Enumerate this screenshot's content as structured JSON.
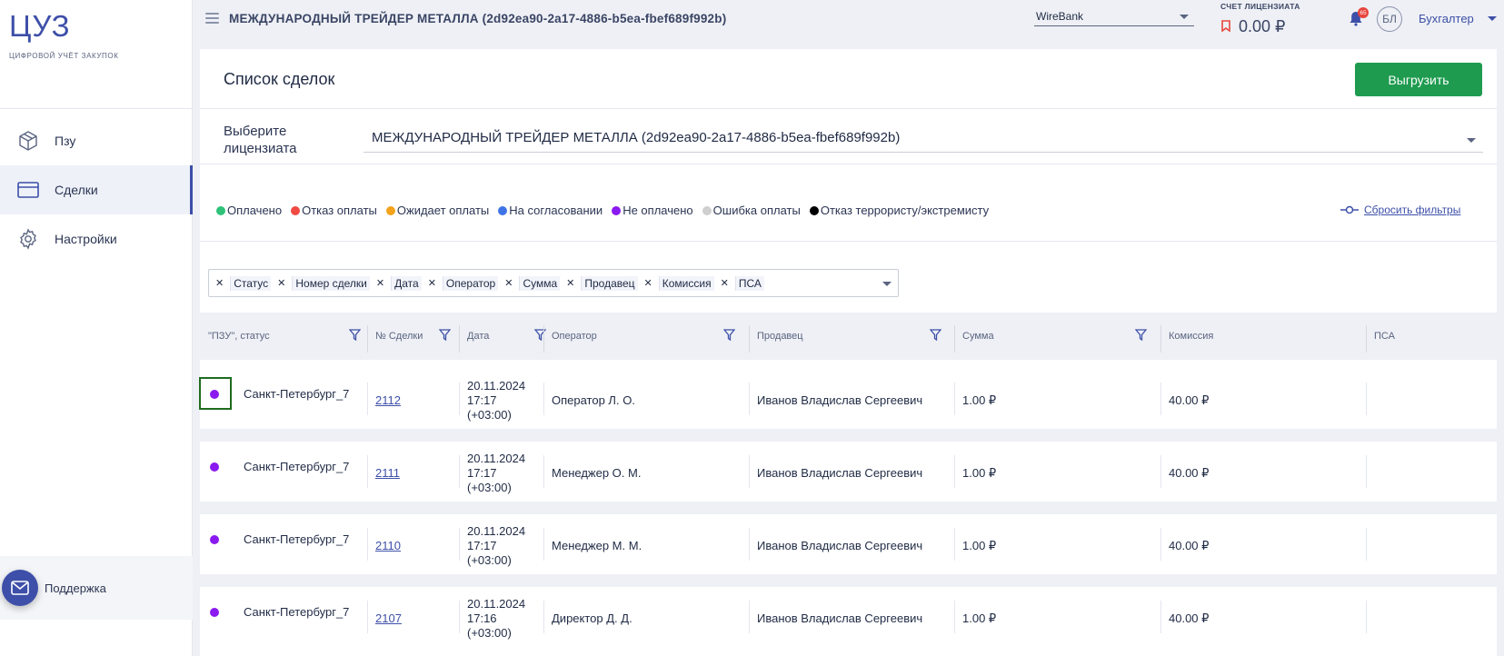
{
  "sidebar": {
    "logo": "ЦУЗ",
    "logo_sub": "ЦИФРОВОЙ УЧЁТ ЗАКУПОК",
    "items": [
      {
        "label": "Пзу",
        "icon": "cube-icon"
      },
      {
        "label": "Сделки",
        "icon": "card-icon",
        "active": true
      },
      {
        "label": "Настройки",
        "icon": "gear-icon"
      }
    ],
    "support_label": "Поддержка"
  },
  "topbar": {
    "title": "МЕЖДУНАРОДНЫЙ ТРЕЙДЕР МЕТАЛЛА (2d92ea90-2a17-4886-b5ea-fbef689f992b)",
    "bank": "WireBank",
    "account_label": "СЧЕТ ЛИЦЕНЗИАТА",
    "account_value": "0.00 ₽",
    "notifications": "65",
    "avatar": "БЛ",
    "role": "Бухгалтер"
  },
  "page": {
    "title": "Список сделок",
    "export_label": "Выгрузить",
    "licensee_label": "Выберите лицензиата",
    "licensee_value": "МЕЖДУНАРОДНЫЙ ТРЕЙДЕР МЕТАЛЛА (2d92ea90-2a17-4886-b5ea-fbef689f992b)",
    "reset_label": "Сбросить фильтры"
  },
  "legend": [
    {
      "label": "Оплачено",
      "color": "#2fc27a"
    },
    {
      "label": "Отказ оплаты",
      "color": "#f04a43"
    },
    {
      "label": "Ожидает оплаты",
      "color": "#f3a31c"
    },
    {
      "label": "На согласовании",
      "color": "#3f74e6"
    },
    {
      "label": "Не оплачено",
      "color": "#8a1aef"
    },
    {
      "label": "Ошибка оплаты",
      "color": "#cfcfcf"
    },
    {
      "label": "Отказ террористу/экстремисту",
      "color": "#000000"
    }
  ],
  "chips": [
    "Статус",
    "Номер сделки",
    "Дата",
    "Оператор",
    "Сумма",
    "Продавец",
    "Комиссия",
    "ПСА"
  ],
  "table": {
    "columns": [
      "\"ПЗУ\", статус",
      "№ Сделки",
      "Дата",
      "Оператор",
      "Продавец",
      "Сумма",
      "Комиссия",
      "ПСА"
    ],
    "rows": [
      {
        "location": "Санкт-Петербург_7",
        "deal": "2112",
        "date": "20.11.2024",
        "time": "17:17",
        "tz": "(+03:00)",
        "operator": "Оператор Л. О.",
        "seller": "Иванов Владислав Сергеевич",
        "sum": "1.00 ₽",
        "commission": "40.00 ₽"
      },
      {
        "location": "Санкт-Петербург_7",
        "deal": "2111",
        "date": "20.11.2024",
        "time": "17:17",
        "tz": "(+03:00)",
        "operator": "Менеджер О. М.",
        "seller": "Иванов Владислав Сергеевич",
        "sum": "1.00 ₽",
        "commission": "40.00 ₽"
      },
      {
        "location": "Санкт-Петербург_7",
        "deal": "2110",
        "date": "20.11.2024",
        "time": "17:17",
        "tz": "(+03:00)",
        "operator": "Менеджер М. М.",
        "seller": "Иванов Владислав Сергеевич",
        "sum": "1.00 ₽",
        "commission": "40.00 ₽"
      },
      {
        "location": "Санкт-Петербург_7",
        "deal": "2107",
        "date": "20.11.2024",
        "time": "17:16",
        "tz": "(+03:00)",
        "operator": "Директор Д. Д.",
        "seller": "Иванов Владислав Сергеевич",
        "sum": "1.00 ₽",
        "commission": "40.00 ₽"
      }
    ]
  }
}
